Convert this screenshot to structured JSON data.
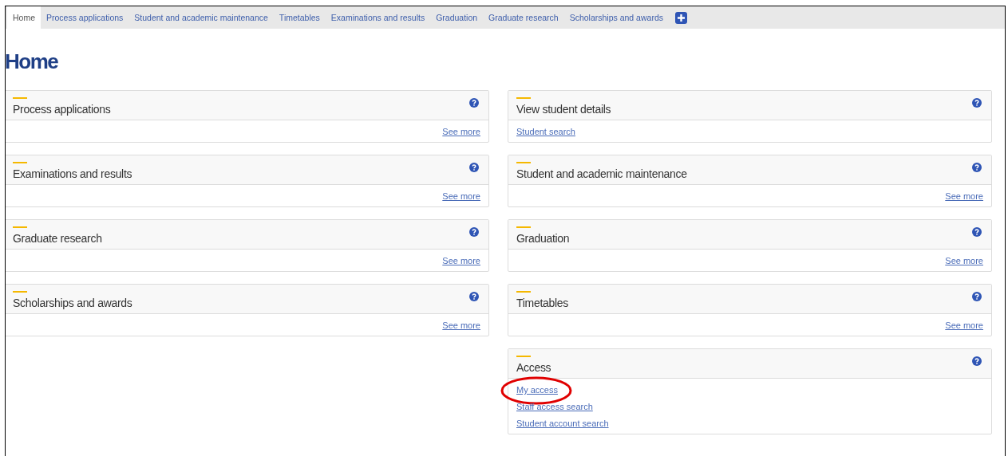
{
  "tabs": [
    {
      "label": "Home",
      "selected": true
    },
    {
      "label": "Process applications",
      "selected": false
    },
    {
      "label": "Student and academic maintenance",
      "selected": false
    },
    {
      "label": "Timetables",
      "selected": false
    },
    {
      "label": "Examinations and results",
      "selected": false
    },
    {
      "label": "Graduation",
      "selected": false
    },
    {
      "label": "Graduate research",
      "selected": false
    },
    {
      "label": "Scholarships and awards",
      "selected": false
    }
  ],
  "page_title": "Home",
  "columns": [
    [
      {
        "title": "Process applications",
        "see_more": "See more"
      },
      {
        "title": "Examinations and results",
        "see_more": "See more"
      },
      {
        "title": "Graduate research",
        "see_more": "See more"
      },
      {
        "title": "Scholarships and awards",
        "see_more": "See more"
      }
    ],
    [
      {
        "title": "View student details",
        "links": [
          {
            "text": "Student search",
            "circled": false
          }
        ]
      },
      {
        "title": "Student and academic maintenance",
        "see_more": "See more"
      },
      {
        "title": "Graduation",
        "see_more": "See more"
      },
      {
        "title": "Timetables",
        "see_more": "See more"
      },
      {
        "title": "Access",
        "links": [
          {
            "text": "My access",
            "circled": true
          },
          {
            "text": "Staff access search",
            "circled": false
          },
          {
            "text": "Student account search",
            "circled": false
          }
        ]
      }
    ]
  ]
}
